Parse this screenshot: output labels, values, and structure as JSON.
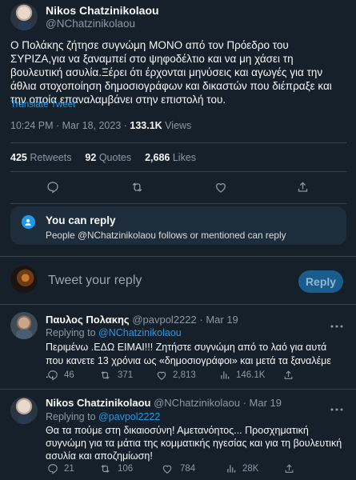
{
  "main_tweet": {
    "author_name": "Nikos Chatzinikolaou",
    "author_handle": "@NChatzinikolaou",
    "text": "Ο Πολάκης ζήτησε συγνώμη ΜΟΝΟ από τον Πρόεδρο του ΣΥΡΙΖΑ,για να ξαναμπεί στο ψηφοδέλτιο και να μη χάσει τη βουλευτική ασυλία.Ξέρει ότι έρχονται μηνύσεις και αγωγές για την άθλια στοχοποίηση δημοσιογράφων και δικαστών που διέπραξε και την οποία επαναλαμβάνει στην επιστολή του.",
    "translate": "Translate Tweet",
    "time": "10:24 PM · Mar 18, 2023 · ",
    "views_count": "133.1K",
    "views_label": " Views",
    "retweets_count": "425",
    "retweets_label": "Retweets",
    "quotes_count": "92",
    "quotes_label": "Quotes",
    "likes_count": "2,686",
    "likes_label": "Likes"
  },
  "reply_restriction": {
    "title": "You can reply",
    "text": "People @NChatzinikolaou follows or mentioned can reply"
  },
  "composer": {
    "placeholder": "Tweet your reply",
    "button": "Reply"
  },
  "replies": [
    {
      "name": "Παυλος Πολακης",
      "handle": "@pavpol2222",
      "date": "· Mar 19",
      "replying_label": "Replying to ",
      "replying_handle": "@NChatzinikolaou",
      "text": "Περιμένω .ΕΔΩ ΕΙΜΑΙ!!! Ζητήστε συγνώμη από το λαό για αυτά που κανετε 13 χρόνια ως «δημοσιογράφοι» και μετά τα ξαναλέμε ...",
      "replies": "46",
      "retweets": "371",
      "likes": "2,813",
      "views": "146.1K"
    },
    {
      "name": "Nikos Chatzinikolaou",
      "handle": "@NChatzinikolaou",
      "date": "· Mar 19",
      "replying_label": "Replying to ",
      "replying_handle": "@pavpol2222",
      "text": "Θα τα πούμε στη δικαιοσύνη! Αμετανόητος... Προσχηματική συγνώμη για τα μάτια της κομματικής ηγεσίας και για τη βουλευτική ασυλία και αποζημίωση!",
      "replies": "21",
      "retweets": "106",
      "likes": "784",
      "views": "28K"
    }
  ],
  "colors": {
    "background": "#15202b",
    "accent": "#1d9bf0",
    "muted": "#8b98a5",
    "divider": "#38444d"
  }
}
